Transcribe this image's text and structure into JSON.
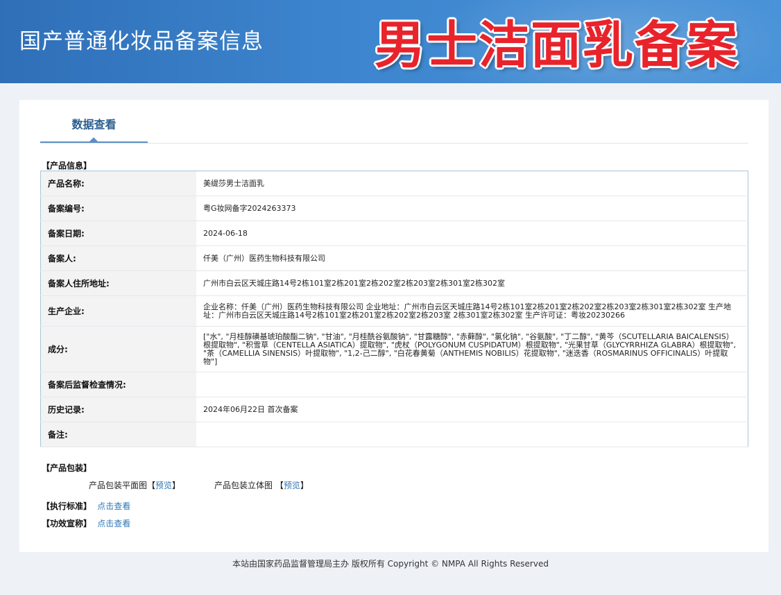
{
  "header": {
    "site_title": "国产普通化妆品备案信息",
    "banner_title": "男士洁面乳备案"
  },
  "tabs": [
    {
      "label": "数据查看"
    }
  ],
  "product_info": {
    "section_label": "【产品信息】",
    "rows": [
      {
        "label": "产品名称:",
        "value": "美缇莎男士洁面乳"
      },
      {
        "label": "备案编号:",
        "value": "粤G妆网备字2024263373"
      },
      {
        "label": "备案日期:",
        "value": "2024-06-18"
      },
      {
        "label": "备案人:",
        "value": "仟美（广州）医药生物科技有限公司"
      },
      {
        "label": "备案人住所地址:",
        "value": "广州市白云区天城庄路14号2栋101室2栋201室2栋202室2栋203室2栋301室2栋302室"
      },
      {
        "label": "生产企业:",
        "value": "企业名称：仟美（广州）医药生物科技有限公司 企业地址：广州市白云区天城庄路14号2栋101室2栋201室2栋202室2栋203室2栋301室2栋302室 生产地址：广州市白云区天城庄路14号2栋101室2栋201室2栋202室2栋203室 2栋301室2栋302室 生产许可证：粤妆20230266"
      },
      {
        "label": "成分:",
        "value": "[\"水\", \"月桂醇磺基琥珀酸酯二钠\", \"甘油\", \"月桂酰谷氨酸钠\", \"甘露糖醇\", \"赤藓醇\", \"氯化钠\", \"谷氨酸\", \"丁二醇\", \"黄芩（SCUTELLARIA BAICALENSIS）根提取物\", \"积雪草（CENTELLA ASIATICA）提取物\", \"虎杖（POLYGONUM CUSPIDATUM）根提取物\", \"光果甘草（GLYCYRRHIZA GLABRA）根提取物\", \"茶（CAMELLIA SINENSIS）叶提取物\", \"1,2-己二醇\", \"白花春黄菊（ANTHEMIS NOBILIS）花提取物\", \"迷迭香（ROSMARINUS OFFICINALIS）叶提取物\"]"
      },
      {
        "label": "备案后监督检查情况:",
        "value": ""
      },
      {
        "label": "历史记录:",
        "value": "2024年06月22日 首次备案"
      },
      {
        "label": "备注:",
        "value": ""
      }
    ]
  },
  "packaging": {
    "section_label": "【产品包装】",
    "flat_label": "产品包装平面图",
    "stereo_label": "产品包装立体图",
    "open_bracket": "【",
    "close_bracket": "】",
    "preview_link": "预览"
  },
  "standard": {
    "section_label": "【执行标准】",
    "link": "点击查看"
  },
  "efficacy": {
    "section_label": "【功效宣称】",
    "link": "点击查看"
  },
  "footer": {
    "text": "本站由国家药品监督管理局主办 版权所有 Copyright © NMPA All Rights Reserved"
  },
  "colors": {
    "header_blue": "#3d86cf",
    "banner_red": "#e8232b",
    "link_blue": "#2f77b6",
    "tab_blue": "#2a5d8f"
  }
}
